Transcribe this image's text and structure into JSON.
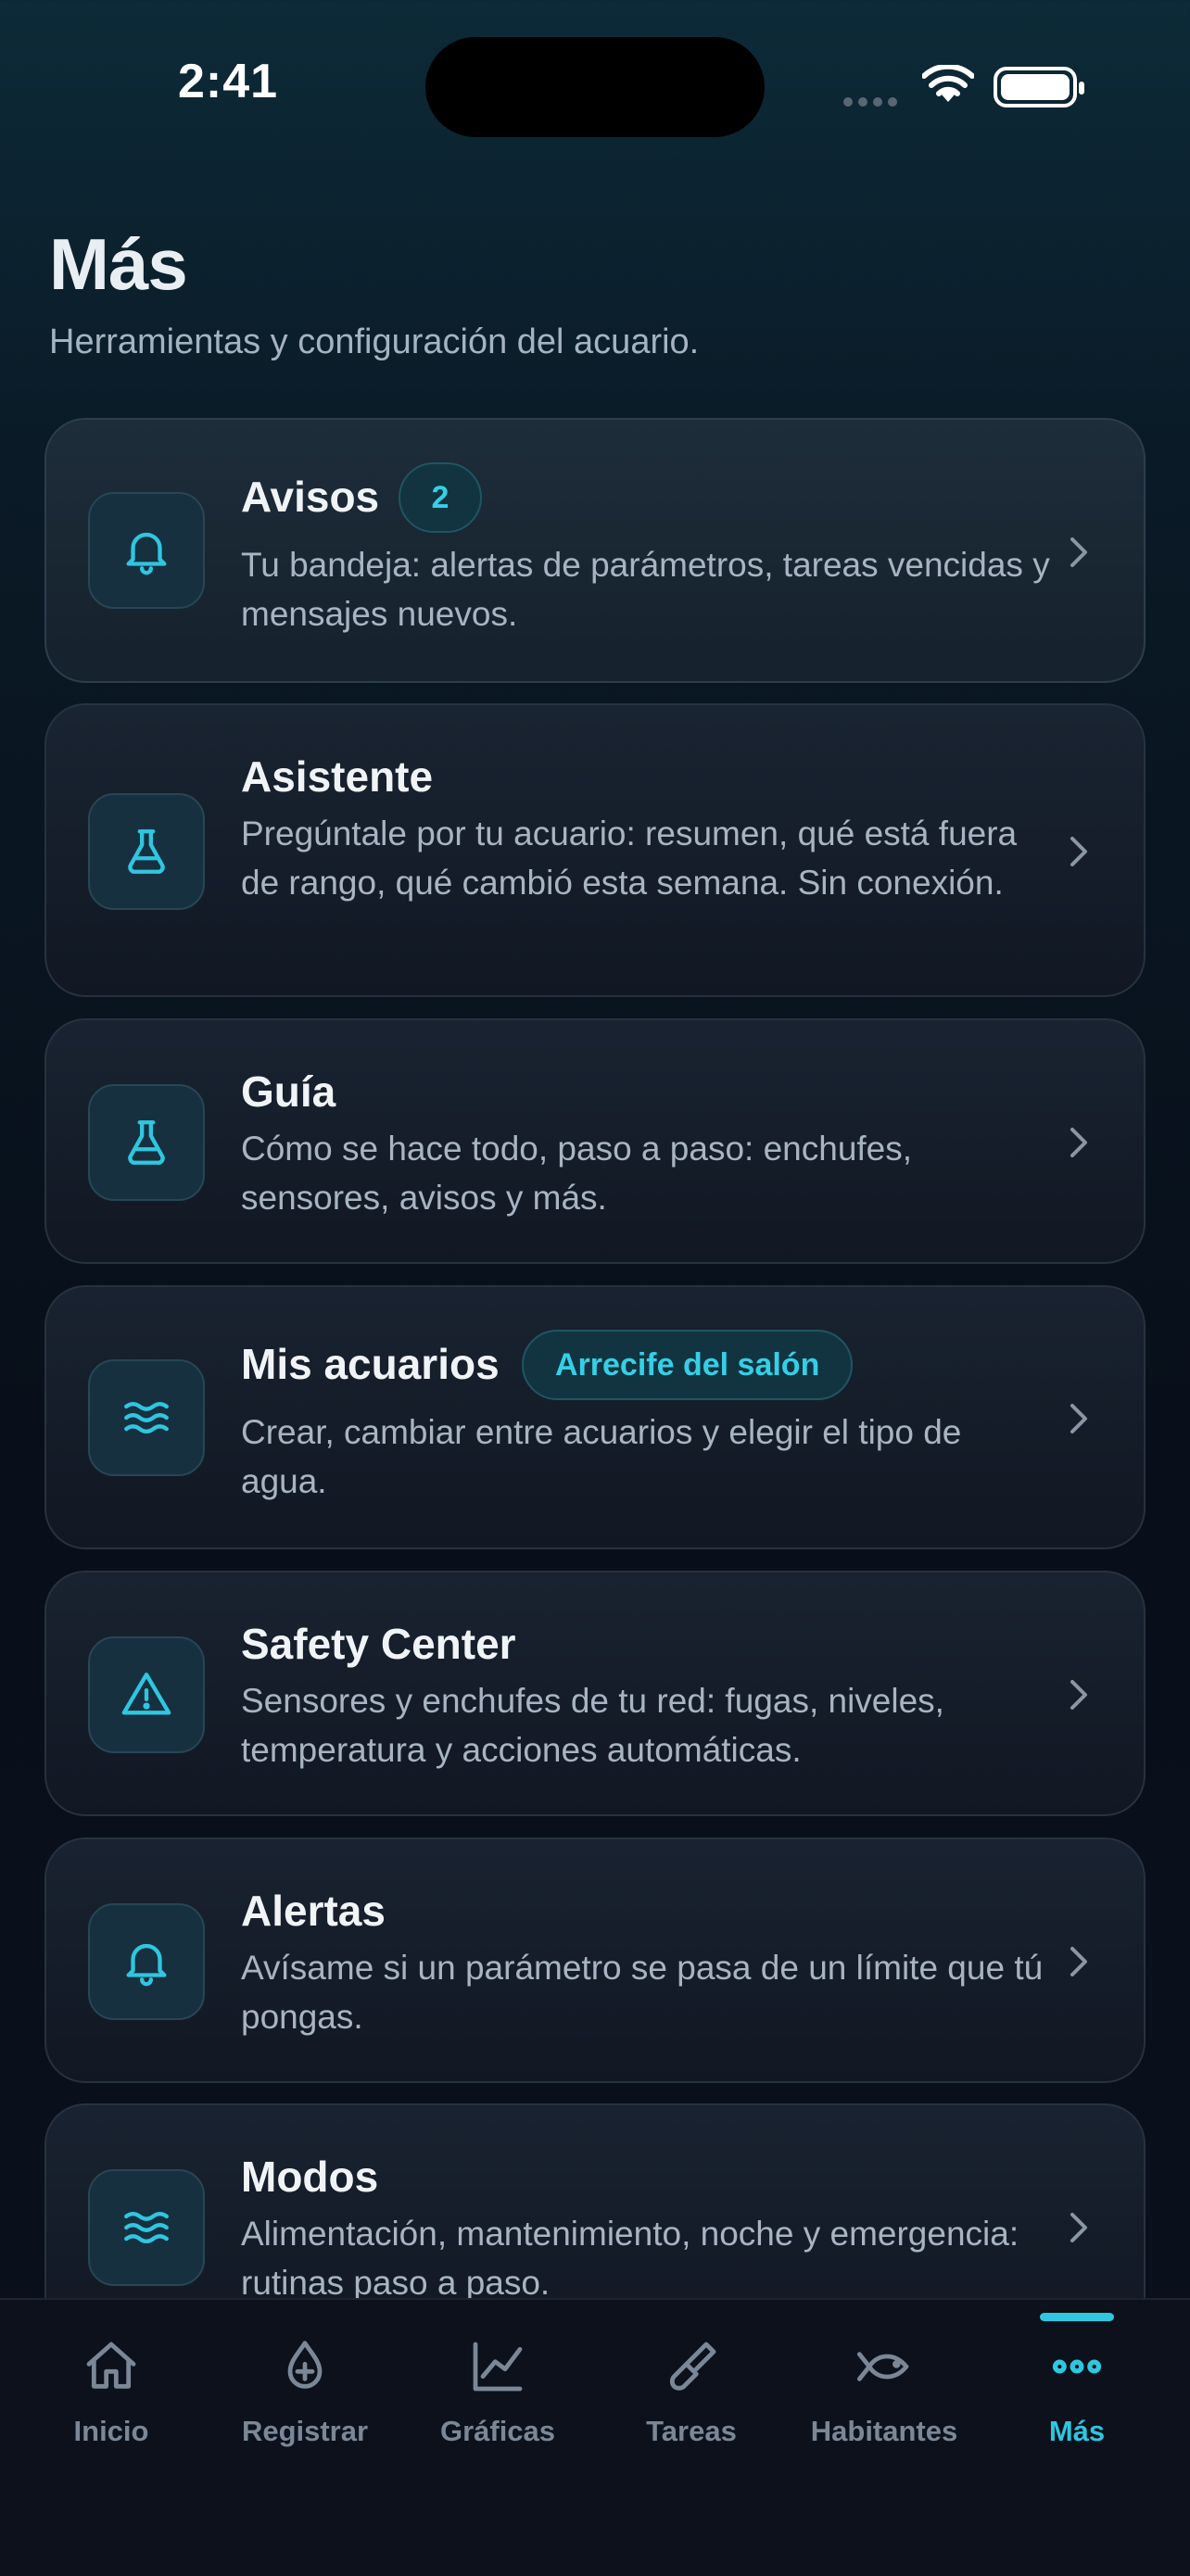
{
  "status_bar": {
    "time": "2:41"
  },
  "page": {
    "title": "Más",
    "subtitle": "Herramientas y configuración del acuario."
  },
  "cards": [
    {
      "title": "Avisos",
      "badge": "2",
      "icon": "bell-icon",
      "desc": "Tu bandeja: alertas de parámetros, tareas vencidas y mensajes nuevos."
    },
    {
      "title": "Asistente",
      "icon": "flask-icon",
      "desc": "Pregúntale por tu acuario: resumen, qué está fuera de rango, qué cambió esta semana. Sin conexión."
    },
    {
      "title": "Guía",
      "icon": "flask-icon",
      "desc": "Cómo se hace todo, paso a paso: enchufes, sensores, avisos y más."
    },
    {
      "title": "Mis acuarios",
      "badge": "Arrecife del salón",
      "icon": "waves-icon",
      "desc": "Crear, cambiar entre acuarios y elegir el tipo de agua."
    },
    {
      "title": "Safety Center",
      "icon": "warning-icon",
      "desc": "Sensores y enchufes de tu red: fugas, niveles, temperatura y acciones automáticas."
    },
    {
      "title": "Alertas",
      "icon": "bell-icon",
      "desc": "Avísame si un parámetro se pasa de un límite que tú pongas."
    },
    {
      "title": "Modos",
      "icon": "waves-icon",
      "desc": "Alimentación, mantenimiento, noche y emergencia: rutinas paso a paso."
    }
  ],
  "tabbar": {
    "items": [
      {
        "label": "Inicio",
        "icon": "home-icon"
      },
      {
        "label": "Registrar",
        "icon": "drop-plus-icon"
      },
      {
        "label": "Gráficas",
        "icon": "chart-icon"
      },
      {
        "label": "Tareas",
        "icon": "brush-icon"
      },
      {
        "label": "Habitantes",
        "icon": "fish-icon"
      },
      {
        "label": "Más",
        "icon": "more-icon",
        "active": true
      }
    ]
  },
  "colors": {
    "accent": "#2fc6e0",
    "background": "#080f1a"
  }
}
